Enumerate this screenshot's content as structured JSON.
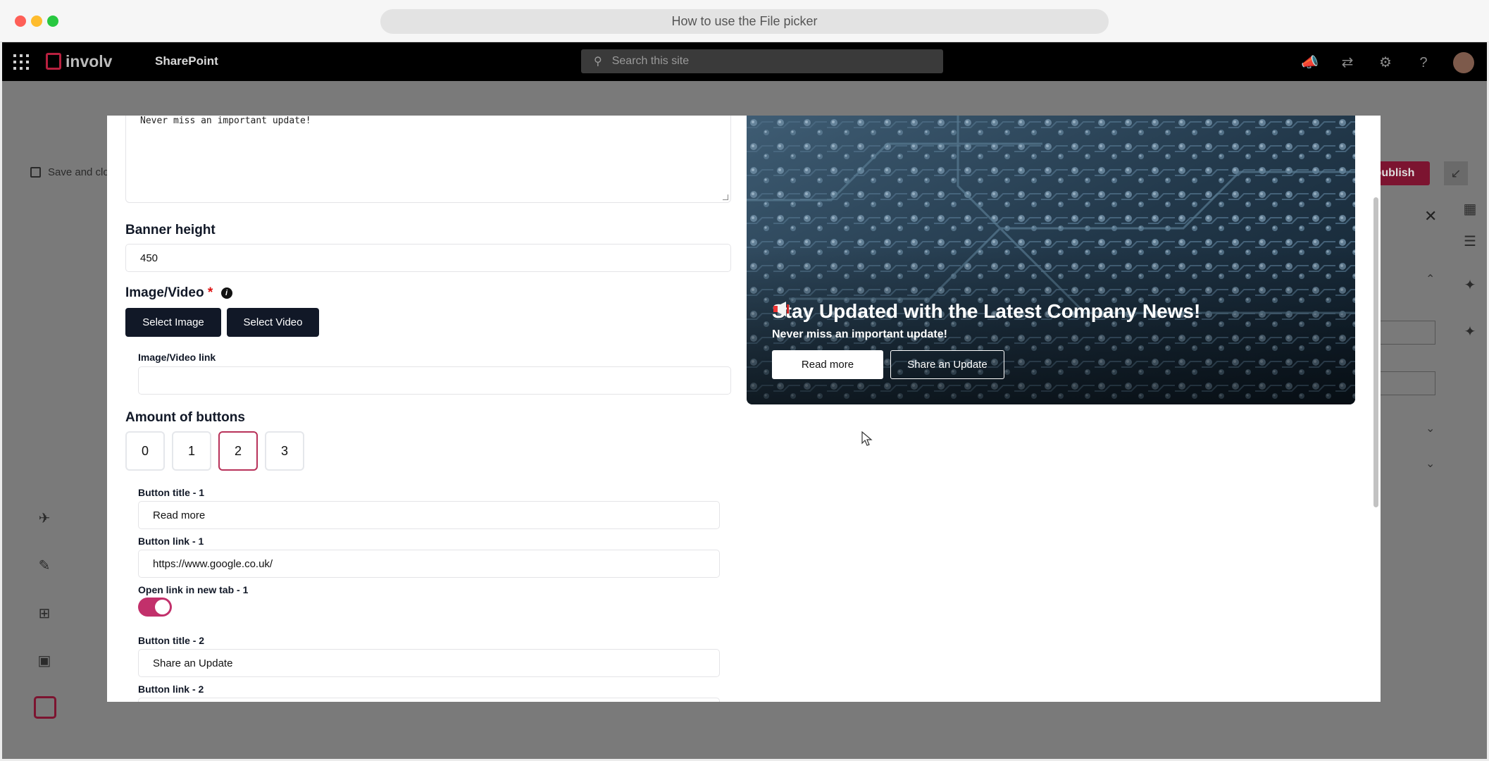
{
  "window": {
    "title": "How to use the File picker"
  },
  "suite": {
    "logo_text": "involv",
    "app_name": "SharePoint",
    "search_placeholder": "Search this site"
  },
  "background": {
    "save_label": "Save and clo",
    "publish_label": "publish"
  },
  "form": {
    "description_value": "Never miss an important update!",
    "banner_height_label": "Banner height",
    "banner_height_value": "450",
    "image_video_label": "Image/Video",
    "required_mark": "*",
    "info_glyph": "i",
    "select_image_label": "Select Image",
    "select_video_label": "Select Video",
    "image_video_link_label": "Image/Video link",
    "image_video_link_value": "",
    "amount_buttons_label": "Amount of buttons",
    "amount_options": [
      "0",
      "1",
      "2",
      "3"
    ],
    "amount_selected": "2",
    "button_title_1_label": "Button title - 1",
    "button_title_1_value": "Read more",
    "button_link_1_label": "Button link - 1",
    "button_link_1_value": "https://www.google.co.uk/",
    "open_new_tab_1_label": "Open link in new tab - 1",
    "open_new_tab_1_on": true,
    "button_title_2_label": "Button title - 2",
    "button_title_2_value": "Share an Update",
    "button_link_2_label": "Button link - 2"
  },
  "preview": {
    "title": "Stay Updated with the Latest Company News!",
    "subtitle": "Never miss an important update!",
    "button_1": "Read more",
    "button_2": "Share an Update"
  },
  "colors": {
    "accent": "#c2306b",
    "dark_button": "#111827",
    "banner_base": "#1f3447"
  }
}
